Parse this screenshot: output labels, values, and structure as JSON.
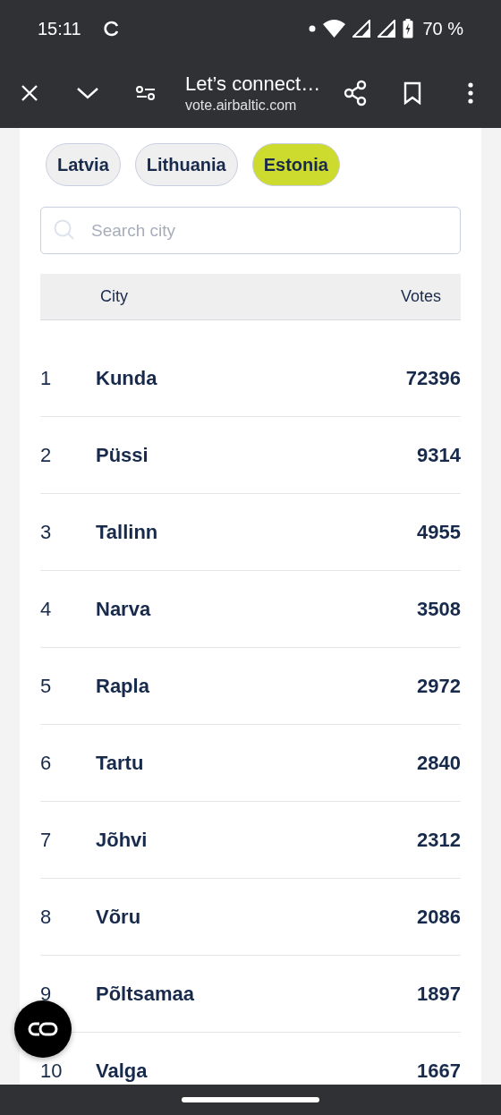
{
  "status_bar": {
    "time": "15:11",
    "battery": "70 %"
  },
  "toolbar": {
    "title": "Let’s connect…",
    "url": "vote.airbaltic.com"
  },
  "tabs": [
    {
      "label": "Latvia",
      "selected": false
    },
    {
      "label": "Lithuania",
      "selected": false
    },
    {
      "label": "Estonia",
      "selected": true
    }
  ],
  "search": {
    "placeholder": "Search city"
  },
  "table": {
    "columns": [
      "City",
      "Votes"
    ],
    "rows": [
      {
        "rank": "1",
        "city": "Kunda",
        "votes": "72396"
      },
      {
        "rank": "2",
        "city": "Püssi",
        "votes": "9314"
      },
      {
        "rank": "3",
        "city": "Tallinn",
        "votes": "4955"
      },
      {
        "rank": "4",
        "city": "Narva",
        "votes": "3508"
      },
      {
        "rank": "5",
        "city": "Rapla",
        "votes": "2972"
      },
      {
        "rank": "6",
        "city": "Tartu",
        "votes": "2840"
      },
      {
        "rank": "7",
        "city": "Jõhvi",
        "votes": "2312"
      },
      {
        "rank": "8",
        "city": "Võru",
        "votes": "2086"
      },
      {
        "rank": "9",
        "city": "Põltsamaa",
        "votes": "1897"
      },
      {
        "rank": "10",
        "city": "Valga",
        "votes": "1667"
      }
    ]
  }
}
